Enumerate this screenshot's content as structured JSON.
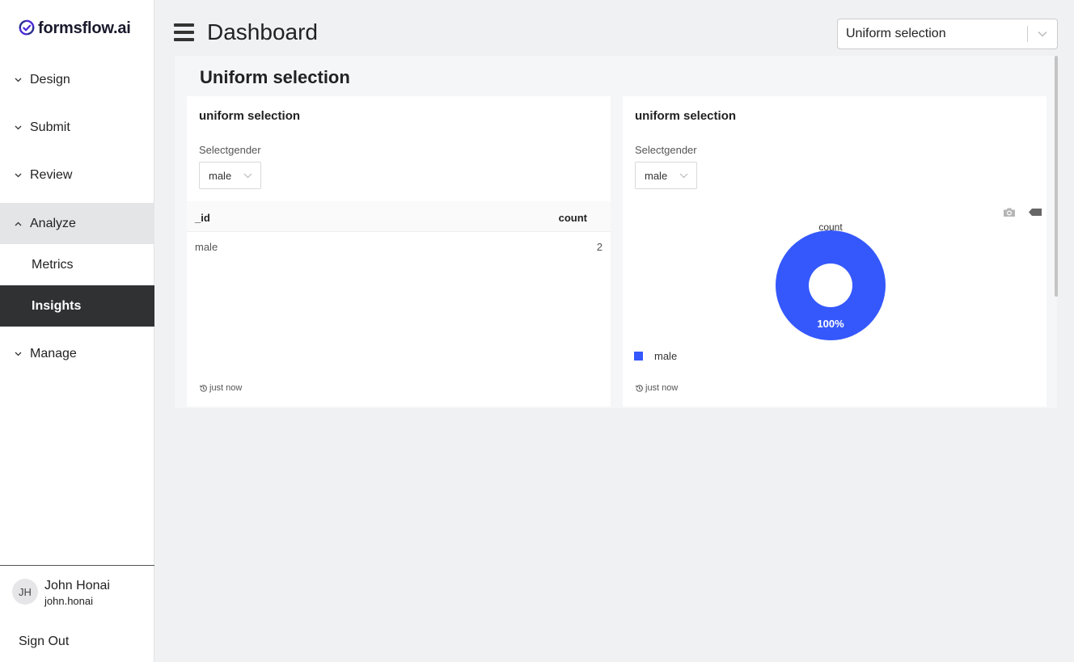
{
  "app": {
    "brand": "formsflow.ai",
    "page_title": "Dashboard",
    "accent": "#3558fc"
  },
  "sidebar": {
    "items": [
      {
        "label": "Design",
        "icon": "chevron-down-icon"
      },
      {
        "label": "Submit",
        "icon": "chevron-down-icon"
      },
      {
        "label": "Review",
        "icon": "chevron-down-icon"
      },
      {
        "label": "Analyze",
        "icon": "chevron-up-icon"
      },
      {
        "label": "Manage",
        "icon": "chevron-down-icon"
      }
    ],
    "analyze_sub": [
      {
        "label": "Metrics"
      },
      {
        "label": "Insights"
      }
    ],
    "user": {
      "initials": "JH",
      "name": "John Honai",
      "login": "john.honai"
    },
    "signout": "Sign Out"
  },
  "header": {
    "dashboard_select": "Uniform selection"
  },
  "panel": {
    "title": "Uniform selection",
    "cards": [
      {
        "title": "uniform selection",
        "filter_label": "Selectgender",
        "filter_value": "male",
        "table": {
          "columns": [
            "_id",
            "count"
          ],
          "rows": [
            [
              "male",
              "2"
            ]
          ]
        },
        "updated": "just now"
      },
      {
        "title": "uniform selection",
        "filter_label": "Selectgender",
        "filter_value": "male",
        "updated": "just now"
      }
    ]
  },
  "chart_data": {
    "type": "pie",
    "title": "count",
    "categories": [
      "male"
    ],
    "values": [
      2
    ],
    "percent_labels": [
      "100%"
    ],
    "colors": [
      "#3558fc"
    ],
    "donut": true,
    "legend_position": "bottom-left"
  }
}
